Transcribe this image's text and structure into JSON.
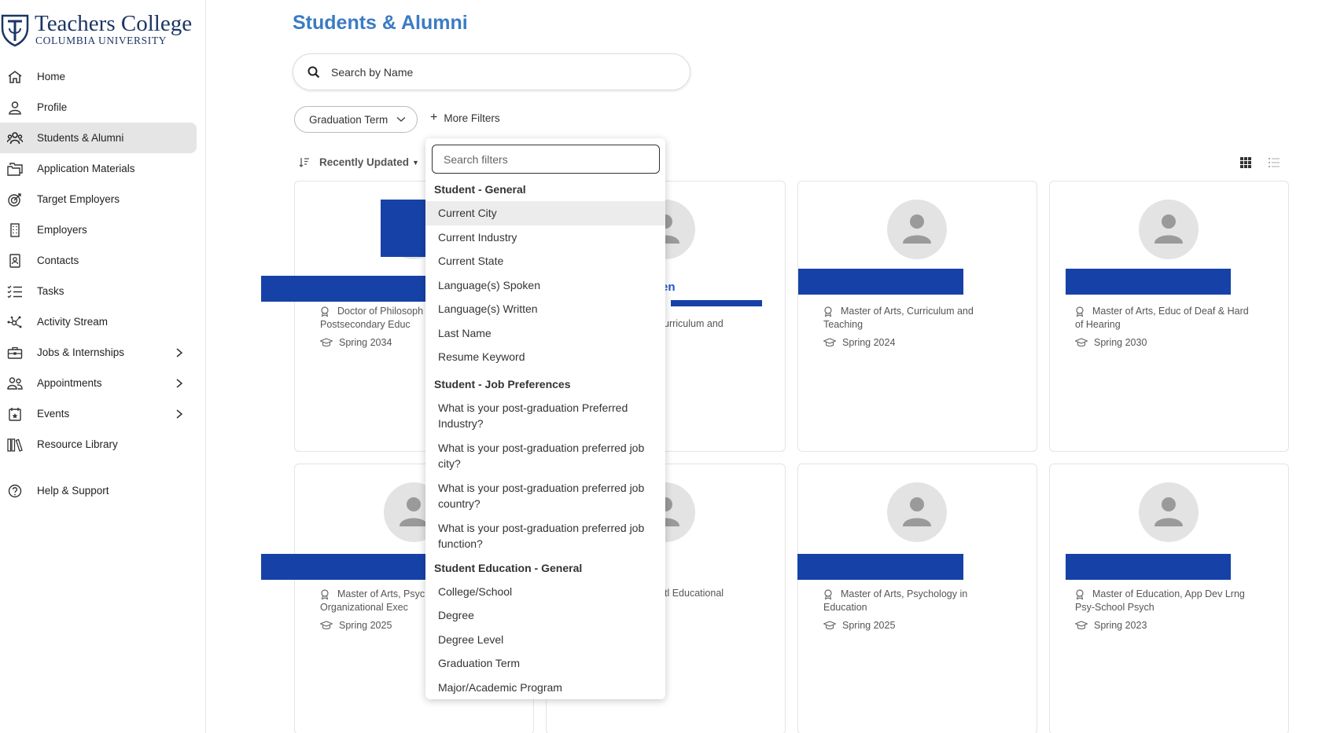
{
  "logo": {
    "line1": "Teachers College",
    "line2": "COLUMBIA UNIVERSITY"
  },
  "sidebar": {
    "items": [
      {
        "label": "Home",
        "icon": "home-icon"
      },
      {
        "label": "Profile",
        "icon": "user-icon"
      },
      {
        "label": "Students & Alumni",
        "icon": "users-icon",
        "active": true
      },
      {
        "label": "Application Materials",
        "icon": "folders-icon"
      },
      {
        "label": "Target Employers",
        "icon": "target-icon"
      },
      {
        "label": "Employers",
        "icon": "building-icon"
      },
      {
        "label": "Contacts",
        "icon": "contact-book-icon"
      },
      {
        "label": "Tasks",
        "icon": "checklist-icon"
      },
      {
        "label": "Activity Stream",
        "icon": "network-icon"
      },
      {
        "label": "Jobs & Internships",
        "icon": "briefcase-icon",
        "expandable": true
      },
      {
        "label": "Appointments",
        "icon": "people-icon",
        "expandable": true
      },
      {
        "label": "Events",
        "icon": "calendar-icon",
        "expandable": true
      },
      {
        "label": "Resource Library",
        "icon": "books-icon"
      },
      {
        "label": "Help & Support",
        "icon": "help-circle-icon"
      }
    ]
  },
  "main": {
    "title": "Students & Alumni",
    "search": {
      "placeholder": "Search by Name",
      "value": ""
    },
    "filters": {
      "graduation_term": "Graduation Term",
      "more_filters": "More Filters"
    },
    "sort": {
      "label": "Recently Updated"
    }
  },
  "cards": [
    {
      "program": [
        "Doctor of Philosoph",
        "Postsecondary Educ"
      ],
      "term": "Spring 2034"
    },
    {
      "name_fragment": "en",
      "program_fragment": "urriculum and"
    },
    {
      "program": [
        "Master of Arts, Curriculum and",
        "Teaching"
      ],
      "term": "Spring 2024"
    },
    {
      "program": [
        "Master of Arts, Educ of Deaf & Hard",
        "of Hearing"
      ],
      "term": "Spring 2030"
    },
    {
      "program": [
        "Master of Arts, Psyc",
        "Organizational Exec"
      ],
      "term": "Spring 2025"
    },
    {
      "program_fragment": "tl Educational"
    },
    {
      "program": [
        "Master of Arts, Psychology in",
        "Education"
      ],
      "term": "Spring 2025"
    },
    {
      "program": [
        "Master of Education, App Dev Lrng",
        "Psy-School Psych"
      ],
      "term": "Spring 2023"
    }
  ],
  "dropdown": {
    "search_placeholder": "Search filters",
    "groups": [
      {
        "title": "Student - General",
        "options": [
          "Current City",
          "Current Industry",
          "Current State",
          "Language(s) Spoken",
          "Language(s) Written",
          "Last Name",
          "Resume Keyword"
        ]
      },
      {
        "title": "Student - Job Preferences",
        "options": [
          "What is your post-graduation Preferred Industry?",
          "What is your post-graduation preferred job city?",
          "What is your post-graduation preferred job country?",
          "What is your post-graduation preferred job function?"
        ]
      },
      {
        "title": "Student Education - General",
        "options": [
          "College/School",
          "Degree",
          "Degree Level",
          "Graduation Term",
          "Major/Academic Program"
        ]
      }
    ]
  },
  "colors": {
    "accent": "#3b7bc4",
    "redaction": "#1642a8",
    "active_nav": "#e5e5e5"
  }
}
